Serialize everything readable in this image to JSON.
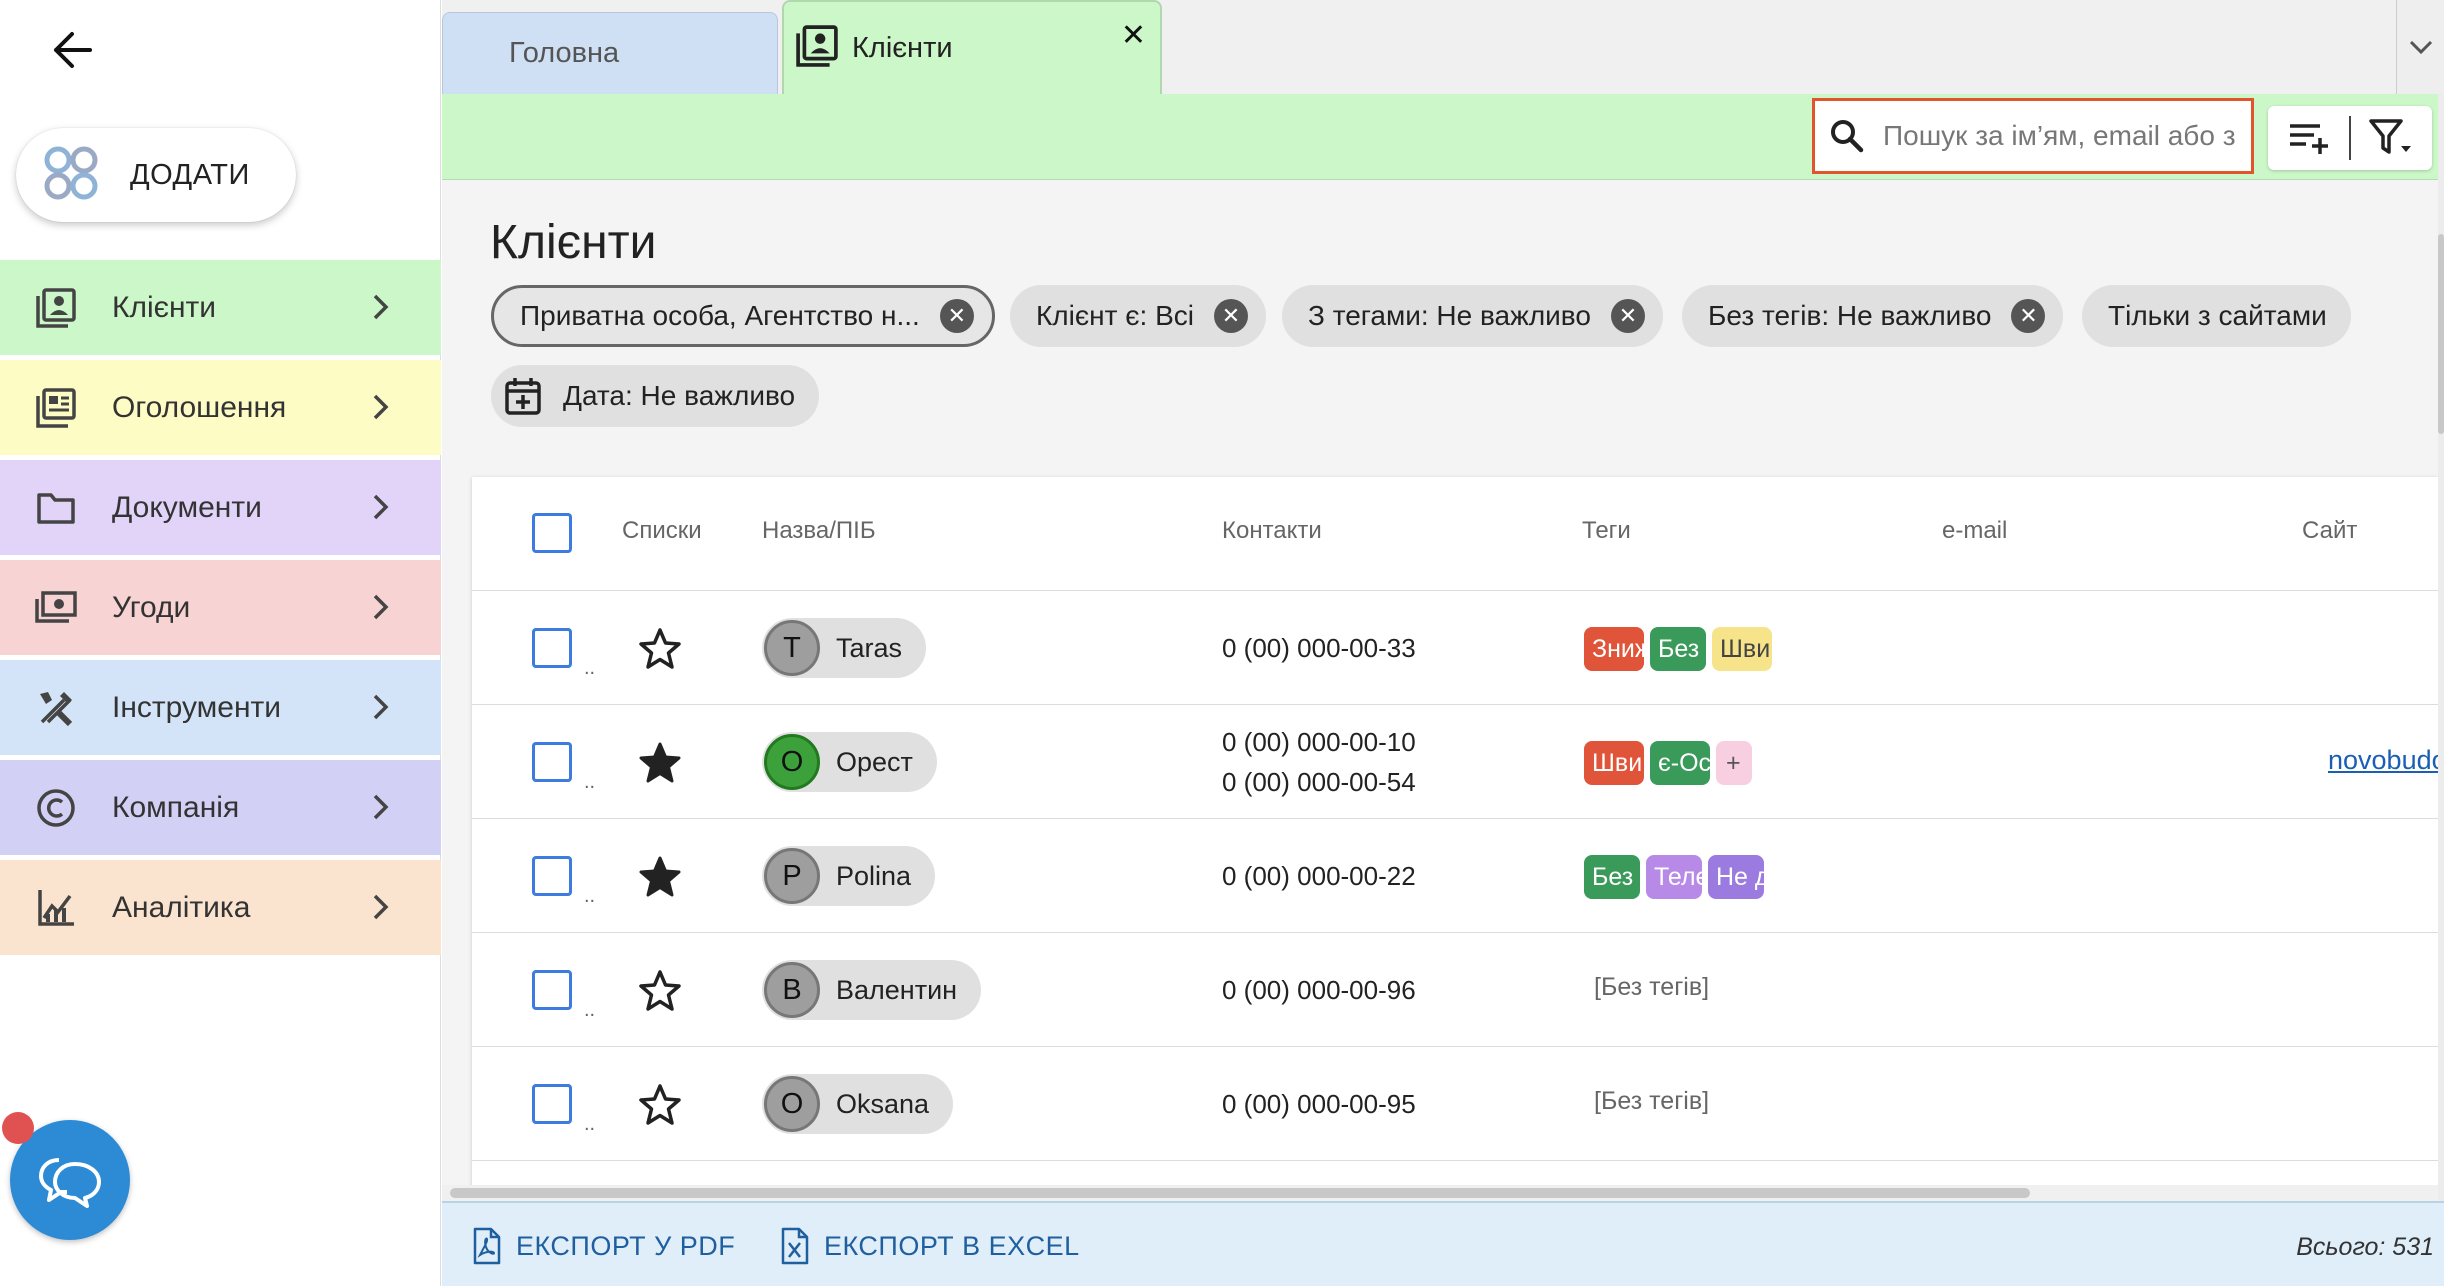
{
  "sidebar": {
    "add_label": "ДОДАТИ",
    "items": [
      {
        "label": "Клієнти",
        "color": "#ccf7c8",
        "icon": "contacts-icon"
      },
      {
        "label": "Оголошення",
        "color": "#fdfcc4",
        "icon": "listings-icon"
      },
      {
        "label": "Документи",
        "color": "#e2d4f8",
        "icon": "folder-icon"
      },
      {
        "label": "Угоди",
        "color": "#f7d3d3",
        "icon": "money-icon"
      },
      {
        "label": "Інструменти",
        "color": "#d3e4f8",
        "icon": "tools-icon"
      },
      {
        "label": "Компанія",
        "color": "#d2d0f5",
        "icon": "copyright-icon"
      },
      {
        "label": "Аналітика",
        "color": "#fae3cf",
        "icon": "analytics-icon"
      }
    ]
  },
  "tabs": {
    "home": "Головна",
    "clients": "Клієнти",
    "close_symbol": "✕"
  },
  "search": {
    "placeholder": "Пошук за ім’ям, email або з"
  },
  "page": {
    "title": "Клієнти"
  },
  "filters": {
    "chip1": "Приватна особа, Агентство н...",
    "chip2": "Клієнт є: Всі",
    "chip3": "З тегами: Не важливо",
    "chip4": "Без тегів: Не важливо",
    "chip5": "Тільки з сайтами",
    "chip6": "Дата: Не важливо"
  },
  "table": {
    "headers": {
      "lists": "Списки",
      "name": "Назва/ПІБ",
      "contacts": "Контакти",
      "tags": "Теги",
      "email": "e-mail",
      "site": "Сайт"
    },
    "row_dots": "..",
    "rows": [
      {
        "initial": "T",
        "name": "Taras",
        "starred": false,
        "phone1": "0 (00) 000-00-33",
        "phone2": "",
        "tags": [
          {
            "text": "Зниж",
            "color": "#e0553a"
          },
          {
            "text": "Без",
            "color": "#3a9a5a"
          },
          {
            "text": "Шви",
            "color": "#f7e48a"
          }
        ],
        "site": ""
      },
      {
        "initial": "О",
        "name": "Орест",
        "starred": true,
        "phone1": "0 (00) 000-00-10",
        "phone2": "0 (00) 000-00-54",
        "tags": [
          {
            "text": "Шви",
            "color": "#e0553a"
          },
          {
            "text": "є-Ос",
            "color": "#3a9a5a"
          },
          {
            "text": "+",
            "color": "#f7cfe0"
          }
        ],
        "site": "novobudov"
      },
      {
        "initial": "P",
        "name": "Polina",
        "starred": true,
        "phone1": "0 (00) 000-00-22",
        "phone2": "",
        "tags": [
          {
            "text": "Без",
            "color": "#3a9a5a"
          },
          {
            "text": "Теле",
            "color": "#b88ae8"
          },
          {
            "text": "Не д",
            "color": "#9b7be0"
          }
        ],
        "site": ""
      },
      {
        "initial": "В",
        "name": "Валентин",
        "starred": false,
        "phone1": "0 (00) 000-00-96",
        "phone2": "",
        "tags": [],
        "no_tags": "[Без тегів]",
        "site": ""
      },
      {
        "initial": "О",
        "name": "Oksana",
        "starred": false,
        "phone1": "0 (00) 000-00-95",
        "phone2": "",
        "tags": [],
        "no_tags": "[Без тегів]",
        "site": ""
      }
    ]
  },
  "footer": {
    "export_pdf": "ЕКСПОРТ У PDF",
    "export_excel": "ЕКСПОРТ В EXCEL",
    "total": "Всього: 531"
  }
}
